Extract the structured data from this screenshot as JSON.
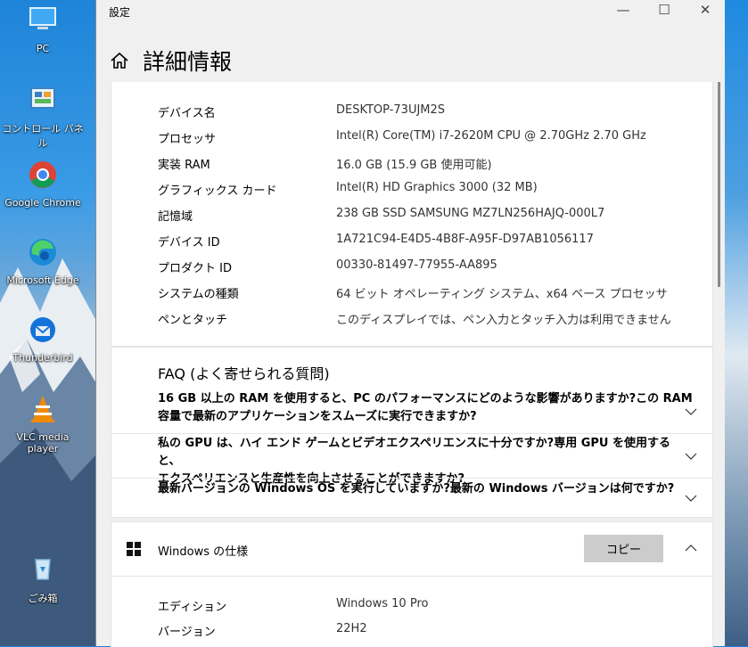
{
  "desktop": {
    "icons": [
      {
        "label": "PC",
        "icon": "pc-icon"
      },
      {
        "label": "コントロール パネル",
        "icon": "control-panel-icon"
      },
      {
        "label": "Google Chrome",
        "icon": "chrome-icon"
      },
      {
        "label": "Microsoft Edge",
        "icon": "edge-icon"
      },
      {
        "label": "Thunderbird",
        "icon": "thunderbird-icon"
      },
      {
        "label": "VLC media player",
        "icon": "vlc-icon"
      },
      {
        "label": "ごみ箱",
        "icon": "recycle-bin-icon"
      }
    ]
  },
  "window": {
    "title": "設定",
    "controls": {
      "minimize": "—",
      "maximize": "☐",
      "close": "✕"
    }
  },
  "header": {
    "title": "詳細情報",
    "home_icon": "home-icon"
  },
  "device_specs": [
    {
      "key": "デバイス名",
      "value": "DESKTOP-73UJM2S"
    },
    {
      "key": "プロセッサ",
      "value": "Intel(R) Core(TM) i7-2620M CPU @ 2.70GHz   2.70 GHz"
    },
    {
      "key": "実装 RAM",
      "value": "16.0 GB (15.9 GB 使用可能)"
    },
    {
      "key": "グラフィックス カード",
      "value": "Intel(R) HD Graphics 3000 (32 MB)"
    },
    {
      "key": "記憶域",
      "value": "238 GB SSD SAMSUNG MZ7LN256HAJQ-000L7"
    },
    {
      "key": "デバイス ID",
      "value": "1A721C94-E4D5-4B8F-A95F-D97AB1056117"
    },
    {
      "key": "プロダクト ID",
      "value": "00330-81497-77955-AA895"
    },
    {
      "key": "システムの種類",
      "value": "64 ビット オペレーティング システム、x64 ベース プロセッサ"
    },
    {
      "key": "ペンとタッチ",
      "value": "このディスプレイでは、ペン入力とタッチ入力は利用できません"
    }
  ],
  "faq": {
    "title": "FAQ (よく寄せられる質問)",
    "items": [
      {
        "line1": "16 GB 以上の RAM を使用すると、PC のパフォーマンスにどのような影響がありますか?この RAM",
        "line2": "容量で最新のアプリケーションをスムーズに実行できますか?"
      },
      {
        "line1": "私の GPU は、ハイ エンド ゲームとビデオエクスペリエンスに十分ですか?専用 GPU を使用すると、",
        "line2": "エクスペリエンスと生産性を向上させることができますか?"
      },
      {
        "line1": "最新バージョンの Windows OS を実行していますか?最新の Windows バージョンは何ですか?",
        "line2": ""
      }
    ]
  },
  "windows_spec": {
    "title": "Windows の仕様",
    "copy_label": "コピー",
    "rows": [
      {
        "key": "エディション",
        "value": "Windows 10 Pro"
      },
      {
        "key": "バージョン",
        "value": "22H2"
      }
    ]
  },
  "colors": {
    "accent_blue": "#0078d7",
    "window_bg": "#f0f0f0",
    "card_bg": "#ffffff",
    "button_bg": "#cccccc"
  }
}
